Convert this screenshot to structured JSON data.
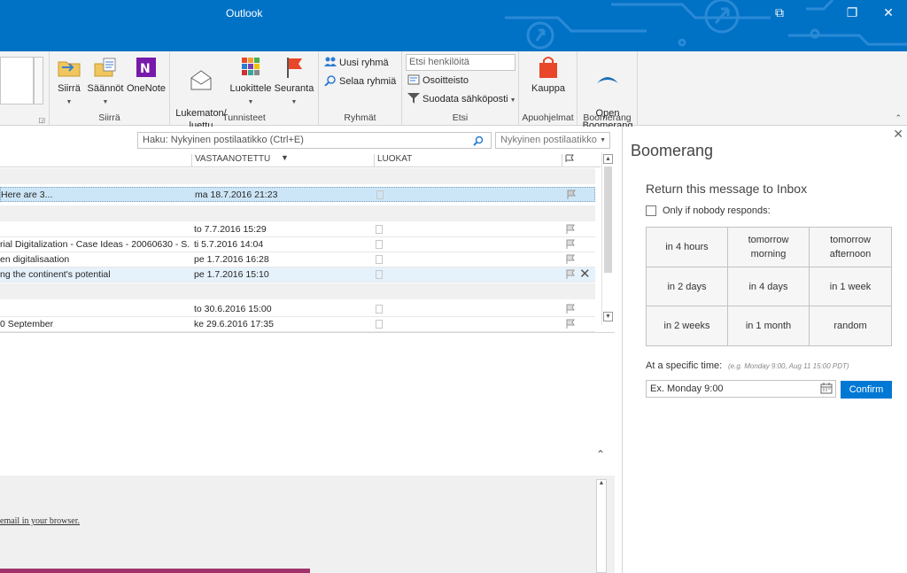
{
  "window": {
    "title": "Outlook",
    "controls": [
      "⧉",
      "❐",
      "✕"
    ]
  },
  "ribbon": {
    "groups": [
      {
        "label": "Siirrä",
        "buttons": [
          "Siirrä",
          "Säännöt",
          "OneNote"
        ]
      },
      {
        "label": "Tunnisteet",
        "buttons": [
          "Lukematon/\nluettu",
          "Luokittele",
          "Seuranta"
        ]
      },
      {
        "label": "Ryhmät",
        "buttons": [
          "Uusi ryhmä",
          "Selaa ryhmiä"
        ]
      },
      {
        "label": "Etsi",
        "search_placeholder": "Etsi henkilöitä",
        "buttons": [
          "Osoitteisto",
          "Suodata sähköposti"
        ]
      },
      {
        "label": "Apuohjelmat",
        "buttons": [
          "Kauppa"
        ]
      },
      {
        "label": "Boomerang",
        "buttons": [
          "Open\nBoomerang"
        ]
      }
    ],
    "colors": {
      "title_bar": "#0072c6",
      "onenote": "#7719aa",
      "kauppa": "#e8472a",
      "boomerang": "#1a6fb5"
    }
  },
  "search": {
    "placeholder": "Haku: Nykyinen postilaatikko (Ctrl+E)",
    "scope": "Nykyinen postilaatikko"
  },
  "mail_list": {
    "columns": {
      "received": "VASTAANOTETTU",
      "categories": "LUOKAT"
    },
    "rows": [
      {
        "subject": "Here are 3...",
        "date": "ma 18.7.2016 21:23",
        "state": "selected"
      },
      {
        "subject": "",
        "date": "to 7.7.2016 15:29",
        "state": ""
      },
      {
        "subject": "rial Digitalization - Case Ideas - 20060630 - S...",
        "date": "ti 5.7.2016 14:04",
        "state": ""
      },
      {
        "subject": "en digitalisaation",
        "date": "pe 1.7.2016 16:28",
        "state": ""
      },
      {
        "subject": "ng the continent's potential",
        "date": "pe 1.7.2016 15:10",
        "state": "hover"
      },
      {
        "subject": "",
        "date": "to 30.6.2016 15:00",
        "state": ""
      },
      {
        "subject": "0 September",
        "date": "ke 29.6.2016 17:35",
        "state": ""
      }
    ]
  },
  "reading_pane": {
    "view_link": "email in your browser."
  },
  "boomerang": {
    "title": "Boomerang",
    "subtitle": "Return this message to Inbox",
    "checkbox_label": "Only if nobody responds:",
    "options": [
      [
        "in 4 hours",
        "tomorrow\nmorning",
        "tomorrow\nafternoon"
      ],
      [
        "in 2 days",
        "in 4 days",
        "in 1 week"
      ],
      [
        "in 2 weeks",
        "in 1 month",
        "random"
      ]
    ],
    "specific_label": "At a specific time:",
    "specific_hint": "(e.g. Monday 9:00, Aug 11 15:00 PDT)",
    "input_placeholder": "Ex. Monday 9:00",
    "confirm_label": "Confirm"
  }
}
